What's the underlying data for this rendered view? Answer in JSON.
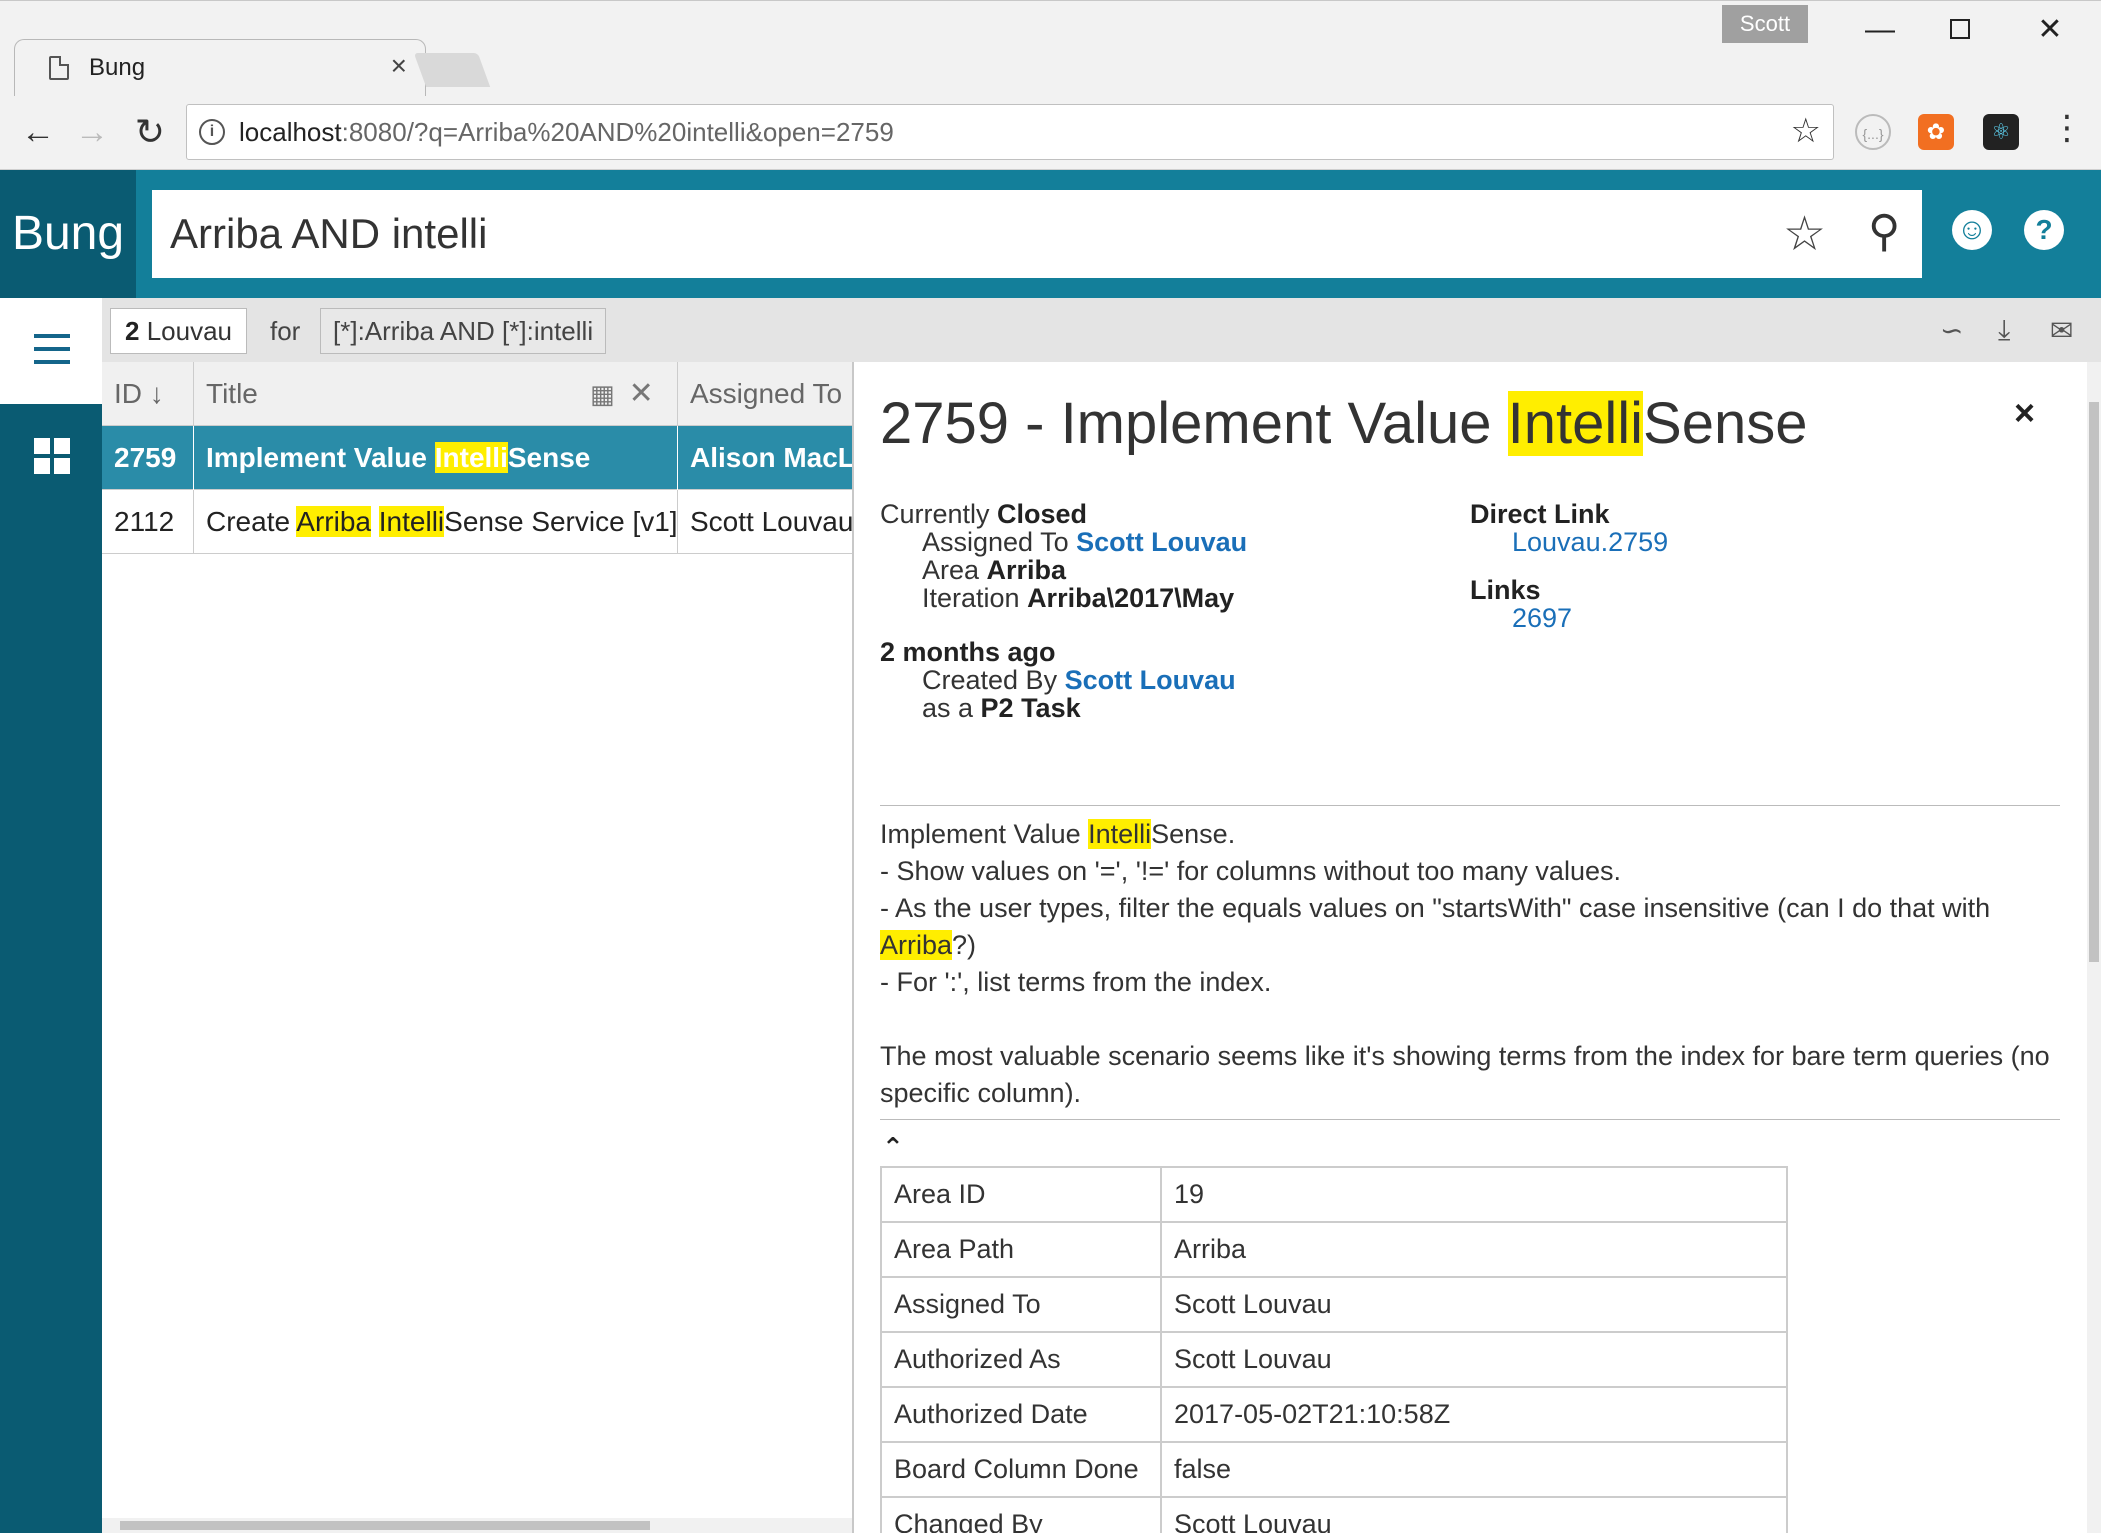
{
  "browser": {
    "tab_title": "Bung",
    "tab_close": "×",
    "profile": "Scott",
    "url_host": "localhost",
    "url_rest": ":8080/?q=Arriba%20AND%20intelli&open=2759",
    "icons": [
      "back-arrow",
      "forward-arrow",
      "reload",
      "info",
      "star",
      "extension",
      "rss",
      "react",
      "menu"
    ]
  },
  "header": {
    "brand": "Bung",
    "search_value": "Arriba AND intelli",
    "accent": "#137f9a",
    "brand_bg": "#0a5b72"
  },
  "results": {
    "count_num": "2",
    "count_label": " Louvau",
    "for_label": "for",
    "query": "[*]:Arriba AND [*]:intelli"
  },
  "grid": {
    "columns": {
      "id": "ID ↓",
      "title": "Title",
      "assigned": "Assigned To"
    },
    "rows": [
      {
        "id": "2759",
        "title_pre": "Implement Value ",
        "title_hl": "Intelli",
        "title_post": "Sense",
        "assigned": "Alison MacL"
      },
      {
        "id": "2112",
        "title_pre": "Create ",
        "title_hl1": "Arriba",
        "title_mid": " ",
        "title_hl2": "Intelli",
        "title_post": "Sense Service [v1]",
        "assigned": "Scott Louvau"
      }
    ]
  },
  "detail": {
    "title_pre": "2759 - Implement Value ",
    "title_hl": "Intelli",
    "title_post": "Sense",
    "close": "×",
    "currently_label": "Currently ",
    "state": "Closed",
    "assigned_label": "Assigned To ",
    "assigned": "Scott Louvau",
    "area_label": "Area ",
    "area": "Arriba",
    "iteration_label": "Iteration ",
    "iteration": "Arriba\\2017\\May",
    "direct_link_label": "Direct Link",
    "direct_link": "Louvau.2759",
    "links_label": "Links",
    "link": "2697",
    "age": "2 months ago",
    "created_label": "Created By ",
    "created_by": "Scott Louvau",
    "as_label": "as a ",
    "type": "P2 Task",
    "desc_l1_pre": "Implement Value ",
    "desc_l1_hl": "Intelli",
    "desc_l1_post": "Sense.",
    "desc_l2": " - Show values on '=', '!=' for columns without too many values.",
    "desc_l3": " - As the user types, filter the equals values on \"startsWith\" case insensitive (can I do that with",
    "desc_l4_hl": "Arriba",
    "desc_l4_post": "?)",
    "desc_l5": " - For ':', list terms from the index.",
    "desc_l6": "The most valuable scenario seems like it's showing terms from the index for bare term queries (no specific column).",
    "properties": [
      {
        "key": "Area ID",
        "value": "19"
      },
      {
        "key": "Area Path",
        "value": "Arriba"
      },
      {
        "key": "Assigned To",
        "value": "Scott Louvau"
      },
      {
        "key": "Authorized As",
        "value": "Scott Louvau"
      },
      {
        "key": "Authorized Date",
        "value": "2017-05-02T21:10:58Z"
      },
      {
        "key": "Board Column Done",
        "value": "false"
      },
      {
        "key": "Changed By",
        "value": "Scott Louvau"
      }
    ]
  }
}
